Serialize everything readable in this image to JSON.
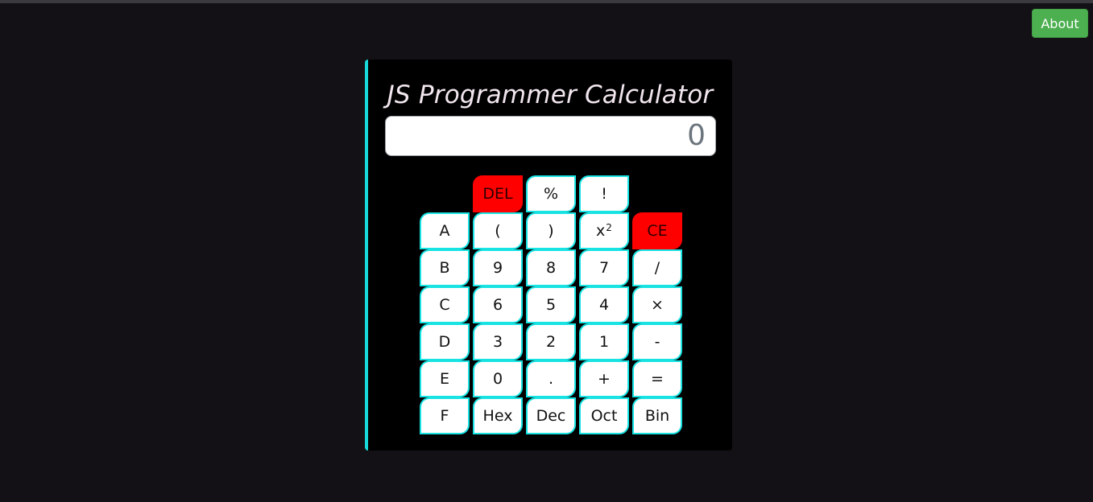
{
  "header": {
    "about_label": "About"
  },
  "calculator": {
    "title": "JS Programmer Calculator",
    "display_value": "0",
    "keys": {
      "del": "DEL",
      "percent": "%",
      "factorial": "!",
      "a": "A",
      "open_paren": "(",
      "close_paren": ")",
      "square_base": "x",
      "square_exp": "2",
      "ce": "CE",
      "b": "B",
      "nine": "9",
      "eight": "8",
      "seven": "7",
      "divide": "/",
      "c": "C",
      "six": "6",
      "five": "5",
      "four": "4",
      "multiply": "×",
      "d": "D",
      "three": "3",
      "two": "2",
      "one": "1",
      "minus": "-",
      "e": "E",
      "zero": "0",
      "dot": ".",
      "plus": "+",
      "equals": "=",
      "f": "F",
      "hex": "Hex",
      "dec": "Dec",
      "oct": "Oct",
      "bin": "Bin"
    }
  },
  "colors": {
    "accent_cyan": "#18e3e3",
    "danger_red": "#ff0000",
    "about_green": "#4caf50",
    "background": "#131115"
  }
}
